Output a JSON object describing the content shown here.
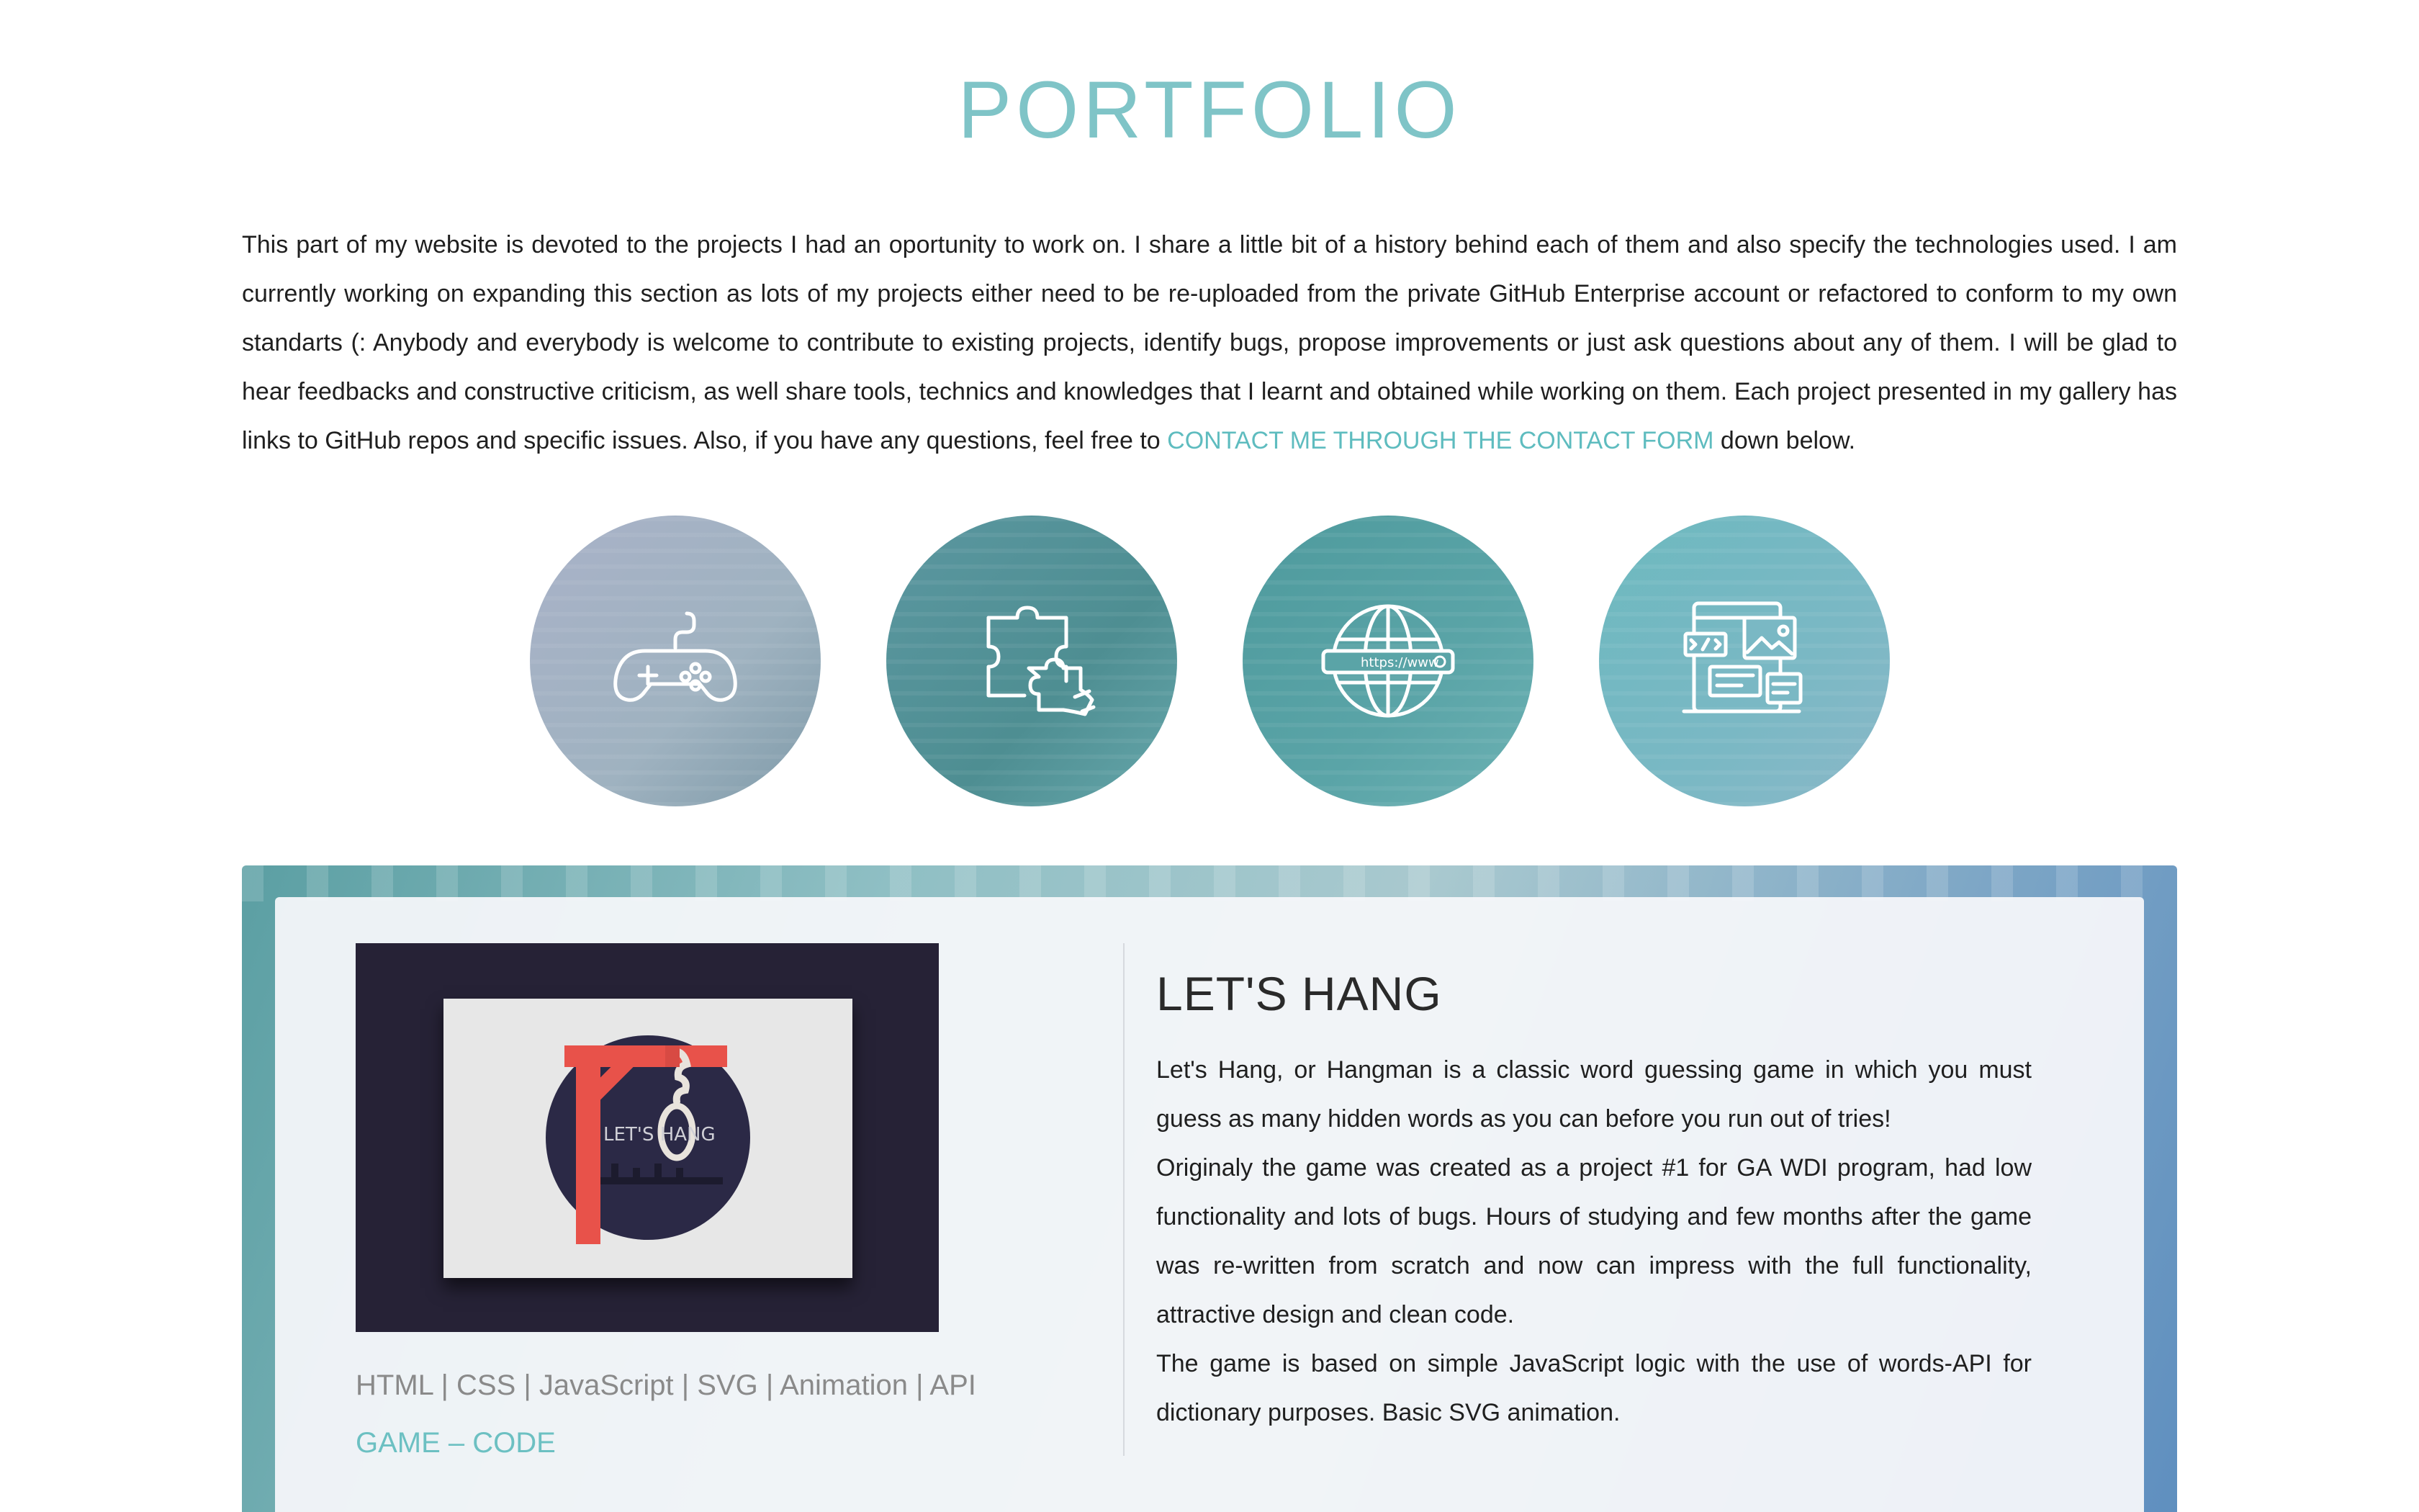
{
  "header": {
    "title": "PORTFOLIO"
  },
  "intro": {
    "text_before": "This part of my website is devoted to the projects I had an oportunity to work on. I share a little bit of a history behind each of them and also specify the technologies used. I am currently working on expanding this section as lots of my projects either need to be re-uploaded from the private GitHub Enterprise account or refactored to conform to my own standarts (: Anybody and everybody is welcome to contribute to existing projects, identify bugs, propose improvements or just ask questions about any of them. I will be glad to hear feedbacks and constructive criticism, as well share tools, technics and knowledges that I learnt and obtained while working on them. Each project presented in my gallery has links to GitHub repos and specific issues. Also, if you have any questions, feel free to ",
    "link_label": "CONTACT ME THROUGH THE CONTACT FORM",
    "text_after": " down below."
  },
  "categories": [
    {
      "icon": "gamepad-icon"
    },
    {
      "icon": "puzzle-icon"
    },
    {
      "icon": "globe-www-icon"
    },
    {
      "icon": "web-design-icon"
    }
  ],
  "project": {
    "title": "LET'S HANG",
    "thumbnail_text": "LET'S HANG",
    "technologies": "HTML | CSS | JavaScript | SVG | Animation | API",
    "game_link": "GAME",
    "separator": " – ",
    "code_link": "CODE",
    "description": [
      "Let's Hang, or Hangman is a classic word guessing game in which you must guess as many hidden words as you can before you run out of tries!",
      "Originaly the game was created as a project #1 for GA WDI program, had low functionality and lots of bugs. Hours of studying and few months after the game was re-written from scratch and now can impress with the full functionality, attractive design and clean code.",
      "The game is based on simple JavaScript logic with the use of words-API for dictionary purposes. Basic SVG animation."
    ]
  },
  "colors": {
    "accent": "#7fc4c7",
    "link": "#5ebcbf",
    "gallows": "#e8524a",
    "thumbnail_bg": "#262236"
  }
}
